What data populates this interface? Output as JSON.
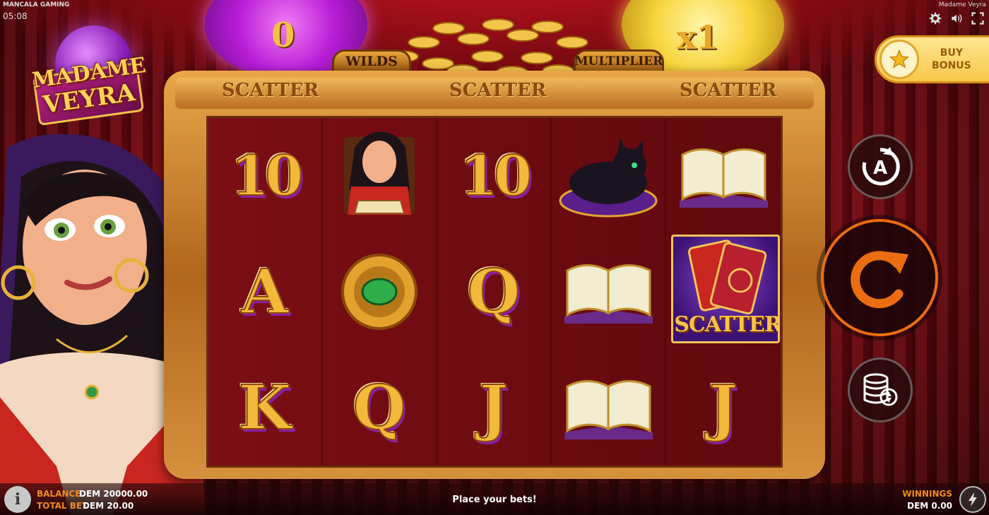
{
  "header": {
    "provider": "MANCALA GAMING",
    "clock": "05:08",
    "game_title": "Madame Veyra"
  },
  "top_icons": [
    "gear-icon",
    "sound-icon",
    "fullscreen-icon"
  ],
  "logo": {
    "line1": "MADAME",
    "line2": "VEYRA"
  },
  "features": {
    "wilds_value": "0",
    "wilds_label": "WILDS",
    "multiplier_value": "x1",
    "multiplier_label": "MULTIPLIER"
  },
  "frame_titles": [
    "SCATTER",
    "SCATTER",
    "SCATTER"
  ],
  "reels": [
    [
      "10",
      "madame",
      "10",
      "black-cat",
      "spellbook"
    ],
    [
      "A",
      "emerald-amulet",
      "Q",
      "spellbook",
      "scatter"
    ],
    [
      "K",
      "Q",
      "J",
      "spellbook",
      "J"
    ]
  ],
  "scatter_symbol_text": "SCATTER",
  "buy_bonus": {
    "line1": "BUY",
    "line2": "BONUS"
  },
  "controls": {
    "autoplay_letter": "A",
    "autoplay_icon": "autoplay-icon",
    "spin_icon": "spin-icon",
    "bet_icon": "coin-stack-icon"
  },
  "bottom_bar": {
    "balance_label": "BALANCE",
    "balance_value": "DEM 20000.00",
    "total_bet_label": "TOTAL BET",
    "total_bet_value": "DEM 20.00",
    "status_message": "Place your bets!",
    "winnings_label": "WINNINGS",
    "winnings_value": "DEM 0.00",
    "info_label": "i"
  },
  "colors": {
    "accent_orange": "#f08a20",
    "spin_ring": "#ea6d12",
    "gold": "#f2b93a",
    "curtain_red": "#b1121d"
  }
}
